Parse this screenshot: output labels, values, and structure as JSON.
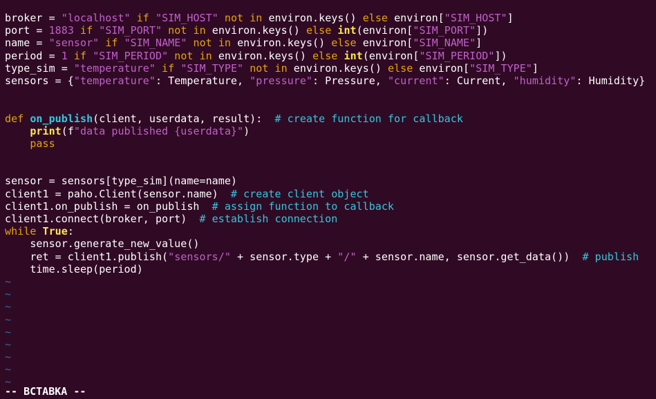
{
  "colors": {
    "background": "#300a24",
    "text": "#ffffff",
    "keyword": "#e5a50a",
    "string": "#c061cb",
    "builtin": "#fce94f",
    "comment": "#33c7de",
    "funcname": "#33c7de",
    "tilde": "#3465a4"
  },
  "code_lines": [
    [
      [
        "t",
        "broker = "
      ],
      [
        "s",
        "\"localhost\""
      ],
      [
        "t",
        " "
      ],
      [
        "k",
        "if"
      ],
      [
        "t",
        " "
      ],
      [
        "s",
        "\"SIM_HOST\""
      ],
      [
        "t",
        " "
      ],
      [
        "k",
        "not in"
      ],
      [
        "t",
        " environ.keys() "
      ],
      [
        "k",
        "else"
      ],
      [
        "t",
        " environ["
      ],
      [
        "s",
        "\"SIM_HOST\""
      ],
      [
        "t",
        "]"
      ]
    ],
    [
      [
        "t",
        "port = "
      ],
      [
        "s",
        "1883"
      ],
      [
        "t",
        " "
      ],
      [
        "k",
        "if"
      ],
      [
        "t",
        " "
      ],
      [
        "s",
        "\"SIM_PORT\""
      ],
      [
        "t",
        " "
      ],
      [
        "k",
        "not in"
      ],
      [
        "t",
        " environ.keys() "
      ],
      [
        "k",
        "else"
      ],
      [
        "t",
        " "
      ],
      [
        "b",
        "int"
      ],
      [
        "t",
        "(environ["
      ],
      [
        "s",
        "\"SIM_PORT\""
      ],
      [
        "t",
        "])"
      ]
    ],
    [
      [
        "t",
        "name = "
      ],
      [
        "s",
        "\"sensor\""
      ],
      [
        "t",
        " "
      ],
      [
        "k",
        "if"
      ],
      [
        "t",
        " "
      ],
      [
        "s",
        "\"SIM_NAME\""
      ],
      [
        "t",
        " "
      ],
      [
        "k",
        "not in"
      ],
      [
        "t",
        " environ.keys() "
      ],
      [
        "k",
        "else"
      ],
      [
        "t",
        " environ["
      ],
      [
        "s",
        "\"SIM_NAME\""
      ],
      [
        "t",
        "]"
      ]
    ],
    [
      [
        "t",
        "period = "
      ],
      [
        "s",
        "1"
      ],
      [
        "t",
        " "
      ],
      [
        "k",
        "if"
      ],
      [
        "t",
        " "
      ],
      [
        "s",
        "\"SIM_PERIOD\""
      ],
      [
        "t",
        " "
      ],
      [
        "k",
        "not in"
      ],
      [
        "t",
        " environ.keys() "
      ],
      [
        "k",
        "else"
      ],
      [
        "t",
        " "
      ],
      [
        "b",
        "int"
      ],
      [
        "t",
        "(environ["
      ],
      [
        "s",
        "\"SIM_PERIOD\""
      ],
      [
        "t",
        "])"
      ]
    ],
    [
      [
        "t",
        "type_sim = "
      ],
      [
        "s",
        "\"temperature\""
      ],
      [
        "t",
        " "
      ],
      [
        "k",
        "if"
      ],
      [
        "t",
        " "
      ],
      [
        "s",
        "\"SIM_TYPE\""
      ],
      [
        "t",
        " "
      ],
      [
        "k",
        "not in"
      ],
      [
        "t",
        " environ.keys() "
      ],
      [
        "k",
        "else"
      ],
      [
        "t",
        " environ["
      ],
      [
        "s",
        "\"SIM_TYPE\""
      ],
      [
        "t",
        "]"
      ]
    ],
    [
      [
        "t",
        "sensors = {"
      ],
      [
        "s",
        "\"temperature\""
      ],
      [
        "t",
        ": Temperature, "
      ],
      [
        "s",
        "\"pressure\""
      ],
      [
        "t",
        ": Pressure, "
      ],
      [
        "s",
        "\"current\""
      ],
      [
        "t",
        ": Current, "
      ],
      [
        "s",
        "\"humidity\""
      ],
      [
        "t",
        ": Humidity}"
      ]
    ],
    [],
    [],
    [
      [
        "k",
        "def"
      ],
      [
        "t",
        " "
      ],
      [
        "f",
        "on_publish"
      ],
      [
        "t",
        "(client, userdata, result):  "
      ],
      [
        "c",
        "# create function for callback"
      ]
    ],
    [
      [
        "t",
        "    "
      ],
      [
        "b",
        "print"
      ],
      [
        "t",
        "(f"
      ],
      [
        "s",
        "\"data published {userdata}\""
      ],
      [
        "t",
        ")"
      ]
    ],
    [
      [
        "t",
        "    "
      ],
      [
        "k",
        "pass"
      ]
    ],
    [],
    [],
    [
      [
        "t",
        "sensor = sensors[type_sim](name=name)"
      ]
    ],
    [
      [
        "t",
        "client1 = paho.Client(sensor.name)  "
      ],
      [
        "c",
        "# create client object"
      ]
    ],
    [
      [
        "t",
        "client1.on_publish = on_publish  "
      ],
      [
        "c",
        "# assign function to callback"
      ]
    ],
    [
      [
        "t",
        "client1.connect(broker, port)  "
      ],
      [
        "c",
        "# establish connection"
      ]
    ],
    [
      [
        "k",
        "while"
      ],
      [
        "t",
        " "
      ],
      [
        "b",
        "True"
      ],
      [
        "t",
        ":"
      ]
    ],
    [
      [
        "t",
        "    sensor.generate_new_value()"
      ]
    ],
    [
      [
        "t",
        "    ret = client1.publish("
      ],
      [
        "s",
        "\"sensors/\""
      ],
      [
        "t",
        " + sensor.type + "
      ],
      [
        "s",
        "\"/\""
      ],
      [
        "t",
        " + sensor.name, sensor.get_data())  "
      ],
      [
        "c",
        "# publish"
      ]
    ],
    [
      [
        "t",
        "    time.sleep(period)"
      ]
    ]
  ],
  "tilde_symbol": "~",
  "tilde_count": 9,
  "mode_indicator": "-- ВСТАВКА --"
}
